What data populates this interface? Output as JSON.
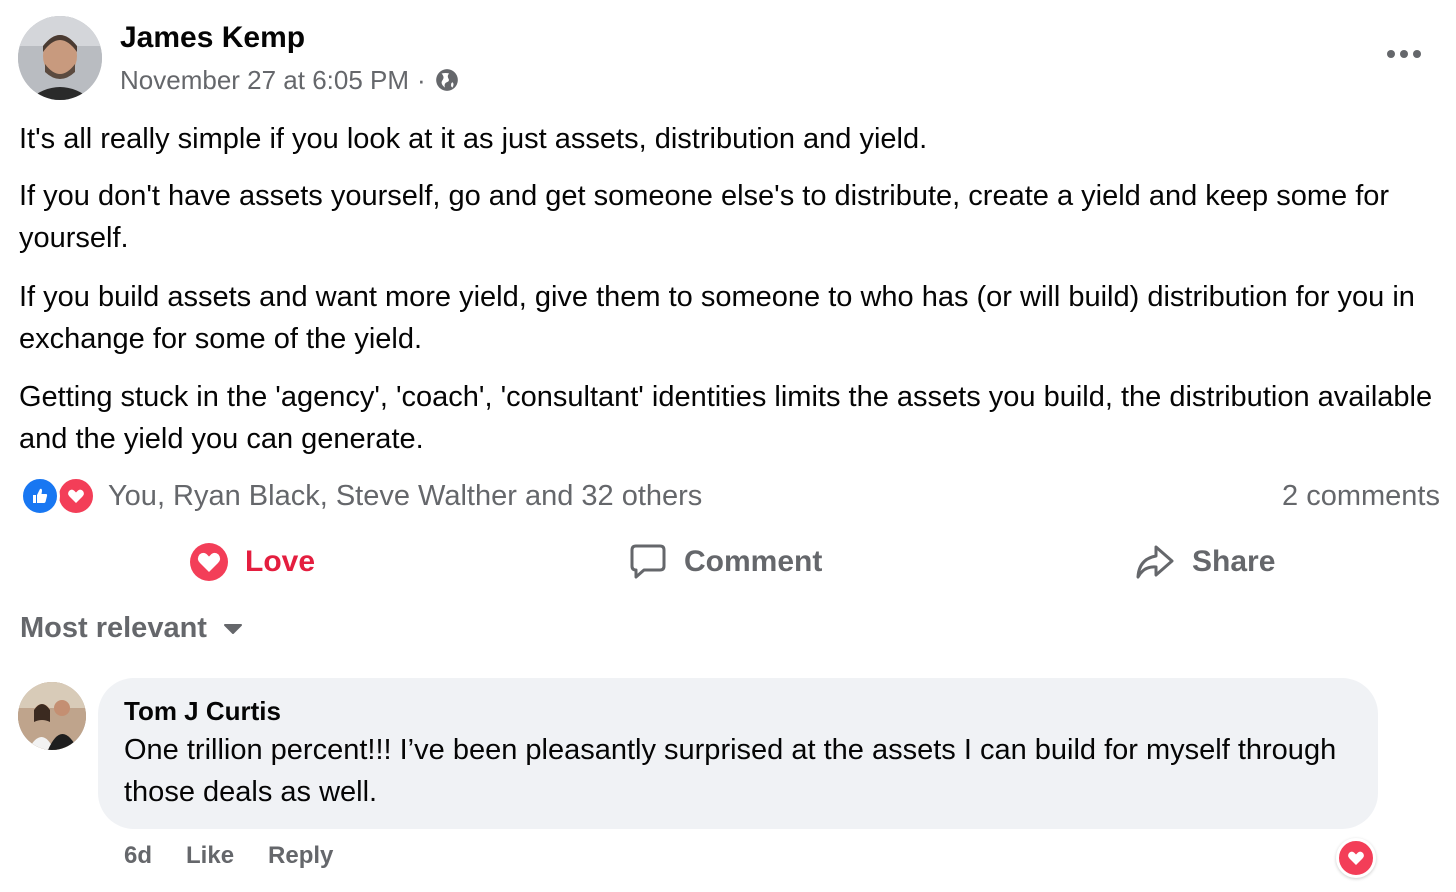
{
  "post": {
    "author_name": "James Kemp",
    "timestamp": "November 27 at 6:05 PM",
    "separator": "·",
    "privacy_icon": "globe-icon",
    "more_icon": "more-horizontal-icon",
    "paragraphs": [
      "It's all really simple if you look at it as just assets, distribution and yield.",
      "If you don't have assets yourself, go and get someone else's to distribute, create a yield and keep some for yourself.",
      "If you build assets and want more yield, give them to someone to who has (or will build) distribution for you in exchange for some of the yield.",
      "Getting stuck in the 'agency', 'coach', 'consultant' identities limits the assets you build, the distribution available and the yield you can generate."
    ]
  },
  "reactions": {
    "summary": "You, Ryan Black, Steve Walther and 32 others",
    "comments_count": "2 comments",
    "icons": [
      "like-icon",
      "love-icon"
    ],
    "colors": {
      "like": "#1877f2",
      "love": "#f33e58"
    }
  },
  "actions": {
    "love_label": "Love",
    "comment_label": "Comment",
    "share_label": "Share",
    "active_color": "#e41e3f"
  },
  "comments_section": {
    "sort_label": "Most relevant",
    "comments": [
      {
        "author": "Tom J Curtis",
        "text": "One trillion percent!!! I’ve been pleasantly surprised at the assets I can build for myself through those deals as well.",
        "time": "6d",
        "like_label": "Like",
        "reply_label": "Reply",
        "reaction_icon": "love-icon"
      }
    ]
  }
}
